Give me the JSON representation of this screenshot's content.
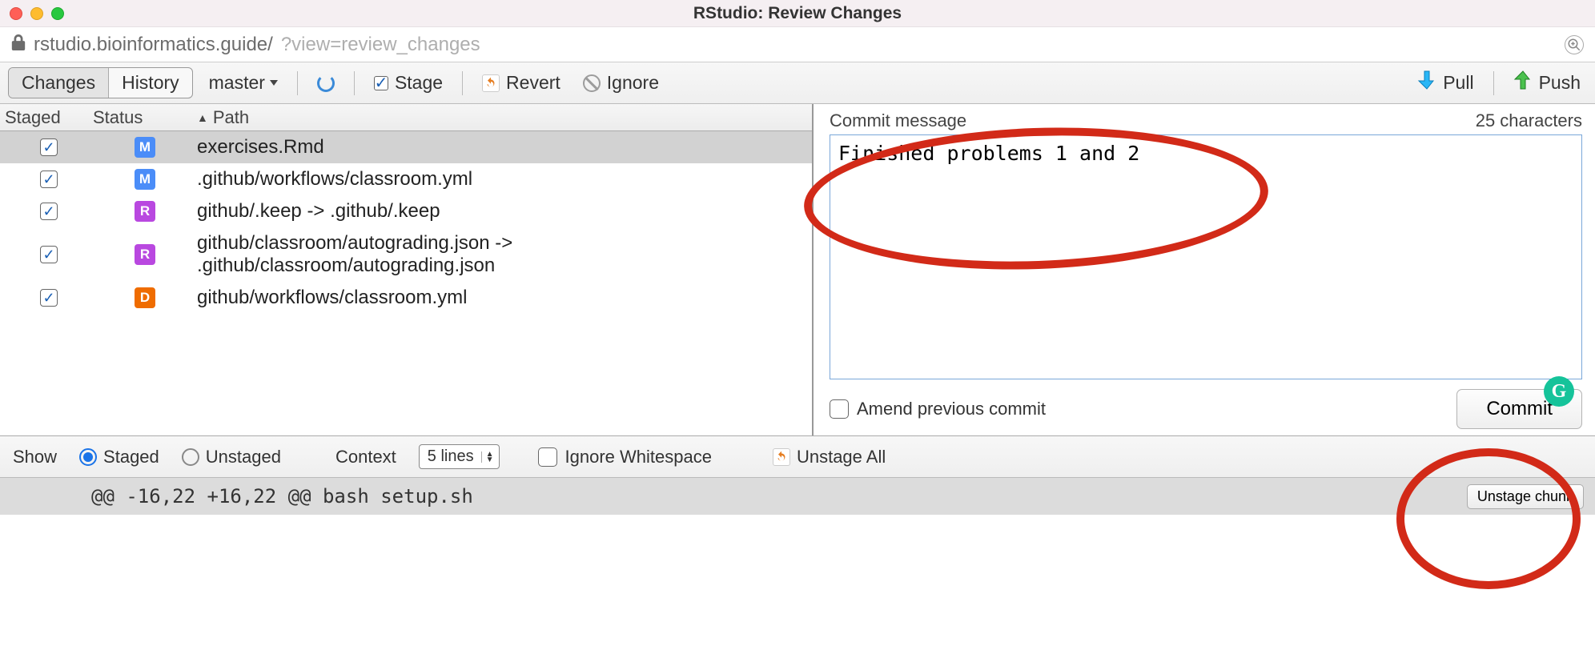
{
  "window": {
    "title": "RStudio: Review Changes"
  },
  "url": {
    "host": "rstudio.bioinformatics.guide/",
    "query": "?view=review_changes"
  },
  "toolbar": {
    "tab_changes": "Changes",
    "tab_history": "History",
    "branch": "master",
    "stage": "Stage",
    "revert": "Revert",
    "ignore": "Ignore",
    "pull": "Pull",
    "push": "Push"
  },
  "columns": {
    "staged": "Staged",
    "status": "Status",
    "path": "Path"
  },
  "files": [
    {
      "staged": true,
      "status": "M",
      "path": "exercises.Rmd",
      "selected": true
    },
    {
      "staged": true,
      "status": "M",
      "path": ".github/workflows/classroom.yml"
    },
    {
      "staged": true,
      "status": "R",
      "path": "github/.keep -> .github/.keep"
    },
    {
      "staged": true,
      "status": "R",
      "path": "github/classroom/autograding.json -> .github/classroom/autograding.json"
    },
    {
      "staged": true,
      "status": "D",
      "path": "github/workflows/classroom.yml"
    }
  ],
  "commit": {
    "label": "Commit message",
    "count": "25 characters",
    "message": "Finished problems 1 and 2",
    "amend": "Amend previous commit",
    "button": "Commit"
  },
  "opts": {
    "show": "Show",
    "staged": "Staged",
    "unstaged": "Unstaged",
    "context": "Context",
    "context_value": "5 lines",
    "ignore_ws": "Ignore Whitespace",
    "unstage_all": "Unstage All"
  },
  "diff": {
    "hunk": "@@ -16,22 +16,22 @@ bash setup.sh",
    "unstage_chunk": "Unstage chunk"
  },
  "grammarly": "G"
}
